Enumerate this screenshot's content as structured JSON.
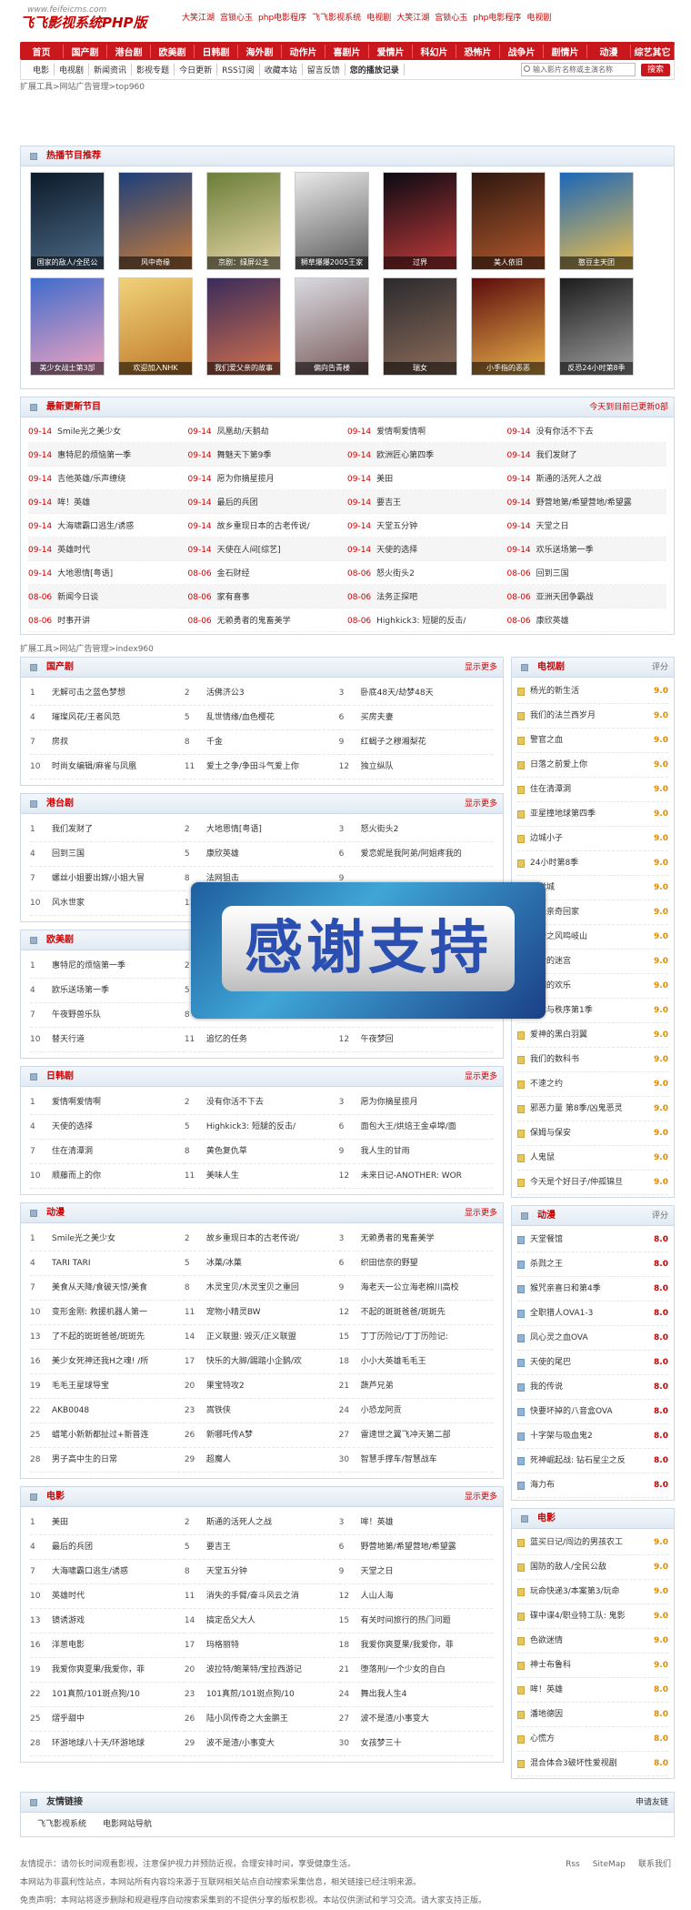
{
  "header": {
    "site_url": "www.feifeicms.com",
    "site_name": "飞飞影视系统PHP版",
    "toplinks": [
      "大笑江湖",
      "宫锁心玉",
      "php电影程序",
      "飞飞影视系统",
      "电视剧",
      "大笑江湖",
      "宫锁心玉",
      "php电影程序",
      "电视剧"
    ]
  },
  "mainnav": [
    "首页",
    "国产剧",
    "港台剧",
    "欧美剧",
    "日韩剧",
    "海外剧",
    "动作片",
    "喜剧片",
    "爱情片",
    "科幻片",
    "恐怖片",
    "战争片",
    "剧情片",
    "动漫",
    "综艺其它"
  ],
  "subnav": [
    "电影",
    "电视剧",
    "新闻资讯",
    "影视专题",
    "今日更新",
    "RSS订阅",
    "收藏本站",
    "留言反馈",
    "您的播放记录"
  ],
  "search": {
    "placeholder": "输入影片名称或主演名称",
    "button": "搜索"
  },
  "crumb1": "扩展工具>网站广告管理>top960",
  "crumb2": "扩展工具>网站广告管理>index960",
  "hot": {
    "title": "热播节目推荐",
    "items": [
      {
        "cap": "国家的敌人/全民公",
        "c1": "#0c1a2a",
        "c2": "#4d6b86"
      },
      {
        "cap": "风中奇缘",
        "c1": "#1d3f7a",
        "c2": "#c87d3c"
      },
      {
        "cap": "京剧：绿屏公主",
        "c1": "#6b7e3a",
        "c2": "#e7d7a6"
      },
      {
        "cap": "狮草爆爆2005王家",
        "c1": "#e9e9e9",
        "c2": "#5a5a5a"
      },
      {
        "cap": "过界",
        "c1": "#0a0a12",
        "c2": "#c23b3b"
      },
      {
        "cap": "美人依旧",
        "c1": "#2e1710",
        "c2": "#b45a2d"
      },
      {
        "cap": "憨豆主天团",
        "c1": "#1b67b8",
        "c2": "#f2c04a"
      },
      {
        "cap": "美少女战士第3部",
        "c1": "#3f6ccc",
        "c2": "#f3a4c0"
      },
      {
        "cap": "欢迎加入NHK",
        "c1": "#f0d27a",
        "c2": "#c07a2a"
      },
      {
        "cap": "我们爱父亲的故事",
        "c1": "#3a2c5c",
        "c2": "#d3704c"
      },
      {
        "cap": "偏向告青楼",
        "c1": "#d9d9e0",
        "c2": "#7a5c5c"
      },
      {
        "cap": "瑞女",
        "c1": "#2b2a2e",
        "c2": "#8d6d5a"
      },
      {
        "cap": "小手指的恶恶",
        "c1": "#5c0c0c",
        "c2": "#e8b04a"
      },
      {
        "cap": "反恐24小时第8季",
        "c1": "#1c1c1c",
        "c2": "#9f9f9f"
      }
    ]
  },
  "updates": {
    "title": "最新更新节目",
    "more": "今天到目前已更新0部",
    "rows": [
      [
        [
          "09-14",
          "Smile光之美少女"
        ],
        [
          "09-14",
          "凤凰劫/天鹅劫"
        ],
        [
          "09-14",
          "爱情啊爱情啊"
        ],
        [
          "09-14",
          "没有你活不下去"
        ]
      ],
      [
        [
          "09-14",
          "惠特尼的烦恼第一季"
        ],
        [
          "09-14",
          "舞魅天下第9季"
        ],
        [
          "09-14",
          "欧洲匠心第四季"
        ],
        [
          "09-14",
          "我们发财了"
        ]
      ],
      [
        [
          "09-14",
          "吉他英雄/乐声缭绕"
        ],
        [
          "09-14",
          "愿为你摘星揽月"
        ],
        [
          "09-14",
          "美田"
        ],
        [
          "09-14",
          "斯通的活死人之战"
        ]
      ],
      [
        [
          "09-14",
          "哞！英雄"
        ],
        [
          "09-14",
          "最后的兵团"
        ],
        [
          "09-14",
          "要吉王"
        ],
        [
          "09-14",
          "野营地第/希望营地/希望露"
        ]
      ],
      [
        [
          "09-14",
          "大海啸霸口逃生/诱惑"
        ],
        [
          "09-14",
          "故乡重现日本的古老传说/"
        ],
        [
          "09-14",
          "天堂五分钟"
        ],
        [
          "09-14",
          "天堂之日"
        ]
      ],
      [
        [
          "09-14",
          "英雄时代"
        ],
        [
          "09-14",
          "天使在人间[综艺]"
        ],
        [
          "09-14",
          "天使的选择"
        ],
        [
          "09-14",
          "欢乐送场第一季"
        ]
      ],
      [
        [
          "09-14",
          "大地恩情[粤语]"
        ],
        [
          "08-06",
          "金石财经"
        ],
        [
          "08-06",
          "怒火街头2"
        ],
        [
          "08-06",
          "回到三国"
        ]
      ],
      [
        [
          "08-06",
          "新闻今日谈"
        ],
        [
          "08-06",
          "家有喜事"
        ],
        [
          "08-06",
          "法务正探吧"
        ],
        [
          "08-06",
          "亚洲天团争霸战"
        ]
      ],
      [
        [
          "08-06",
          "时事开讲"
        ],
        [
          "08-06",
          "无赖勇者的鬼畜美学"
        ],
        [
          "08-06",
          "Highkick3: 短腿的反击/"
        ],
        [
          "08-06",
          "康欣英雄"
        ]
      ]
    ]
  },
  "sections": [
    {
      "title": "国产剧",
      "more": "显示更多",
      "items": [
        "无解可击之蓝色梦想",
        "活佛济公3",
        "卧底48天/劫梦48天",
        "璀璨风花/王者风范",
        "乱世情缘/血色樱花",
        "买房夫妻",
        "房叔",
        "千金",
        "红蝎子之穆湘梨花",
        "时尚女编辑/麻雀与凤凰",
        "爱土之争/争田斗气爱上你",
        "独立纵队"
      ]
    },
    {
      "title": "港台剧",
      "more": "显示更多",
      "items": [
        "我们发财了",
        "大地恩情[粤语]",
        "怒火街头2",
        "回到三国",
        "康欣英雄",
        "爱恋妮是我阿弟/阿姐疼我的",
        "螺丝小姐要出嫁/小姐大冒",
        "法网狙击",
        "",
        "风水世家",
        "",
        ""
      ]
    },
    {
      "title": "欧美剧",
      "more": "显示更多",
      "items": [
        "惠特尼的烦恼第一季",
        "",
        "",
        "欧乐送场第一季",
        "",
        "",
        "午夜野兽乐队",
        "微博有鬼之@直播",
        "仙境大逃课杀案",
        "替天行道",
        "追忆的任务",
        "午夜梦回"
      ]
    },
    {
      "title": "日韩剧",
      "more": "显示更多",
      "items": [
        "爱情啊爱情啊",
        "没有你活不下去",
        "愿为你摘星揽月",
        "天使的选择",
        "Highkick3: 短腿的反击/",
        "面包大王/烘焙王金卓埠/面",
        "住在清潭洞",
        "黄色复仇草",
        "我人生的甘雨",
        "顺藤而上的你",
        "美味人生",
        "未来日记-ANOTHER: WOR"
      ]
    },
    {
      "title": "动漫",
      "more": "显示更多",
      "items": [
        "Smile光之美少女",
        "故乡重现日本的古老传说/",
        "无赖勇者的鬼畜美学",
        "TARI TARI",
        "冰菓/冰菓",
        "织田信奈的野望",
        "美食从天降/食破天惊/美食",
        "木灵宝贝/木灵宝贝之重回",
        "海老天一公立海老棉川高校",
        "变形金刚: 救援机器人第一",
        "宠物小精灵BW",
        "不起的斑斑爸爸/斑斑先",
        "了不起的斑斑爸爸/斑斑先",
        "正义联盟: 毁灭/正义联盟",
        "丁丁历险记/丁丁历险记:",
        "美少女死神还我H之魂! /所",
        "快乐的大脚/踢踏小企鹅/欢",
        "小小大英雄毛毛王",
        "毛毛王星球导宝",
        "果宝特攻2",
        "蔬芦兄弟",
        "AKB0048",
        "嵩铁侠",
        "小恐龙阿贡",
        "蜡笔小新新都扯过+新普连",
        "新哪吒传A梦",
        "雷速世之翼飞冲天第二部",
        "男子高中生的日常",
        "超魔人",
        "智慧手撑车/智慧战车"
      ]
    },
    {
      "title": "电影",
      "more": "显示更多",
      "items": [
        "美田",
        "斯通的活死人之战",
        "哞！英雄",
        "最后的兵团",
        "要吉王",
        "野营地第/希望营地/希望露",
        "大海啸霸口逃生/诱惑",
        "天堂五分钟",
        "天堂之日",
        "英雄时代",
        "消失的手臂/奋斗风云之消",
        "人山人海",
        "镜诱游戏",
        "搞定岳父大人",
        "有关时间旅行的热门问题",
        "洋葱电影",
        "玛格丽特",
        "我爱你爽夏果/我爱你，菲",
        "我爱你爽夏果/我爱你，菲",
        "波拉特/鲍莱特/宝拉西游记",
        "堕落刑/一个少女的自白",
        "101真煎/101斑点狗/10",
        "101真煎/101斑点狗/10",
        "舞出我人生4",
        "熠乎甜中",
        "陆小凤传奇之大金鹏王",
        "波不是渣/小事变大",
        "环游地球八十天/环游地球",
        "波不是渣/小事变大",
        "女孩梦三十"
      ]
    }
  ],
  "right": [
    {
      "title": "电视剧",
      "col": "评分",
      "items": [
        [
          "杨光的新生活",
          "9.0"
        ],
        [
          "我们的法兰西岁月",
          "9.0"
        ],
        [
          "警官之血",
          "9.0"
        ],
        [
          "日落之前爱上你",
          "9.0"
        ],
        [
          "住在清潭洞",
          "9.0"
        ],
        [
          "亚星撞地球第四季",
          "9.0"
        ],
        [
          "边城小子",
          "9.0"
        ],
        [
          "24小时第8季",
          "9.0"
        ],
        [
          "幻觉城",
          "9.0"
        ],
        [
          "快乐亲奇回家",
          "9.0"
        ],
        [
          "特警之风鸣岐山",
          "9.0"
        ],
        [
          "最后的迷宫",
          "9.0"
        ],
        [
          "我们的欢乐",
          "9.0"
        ],
        [
          "法律与秩序第1季",
          "9.0"
        ],
        [
          "爱神的黑白羽翼",
          "9.0"
        ],
        [
          "我们的数科书",
          "9.0"
        ],
        [
          "不速之约",
          "9.0"
        ],
        [
          "邪恶力量 第8季/凶鬼恶灵",
          "9.0"
        ],
        [
          "保姆与保安",
          "9.0"
        ],
        [
          "人鬼鼠",
          "9.0"
        ],
        [
          "今天是个好日子/仲孤锦旦",
          "9.0"
        ]
      ]
    },
    {
      "title": "动漫",
      "col": "评分",
      "items": [
        [
          "天堂餐馆",
          "8.0"
        ],
        [
          "杀戮之王",
          "8.0"
        ],
        [
          "猴咒亲喜日和第4季",
          "8.0"
        ],
        [
          "全职猎人OVA1-3",
          "8.0"
        ],
        [
          "凤心灵之血OVA",
          "8.0"
        ],
        [
          "天使的尾巴",
          "8.0"
        ],
        [
          "我的传说",
          "8.0"
        ],
        [
          "快要坏掉的八音盒OVA",
          "8.0"
        ],
        [
          "十字架与吸血鬼2",
          "8.0"
        ],
        [
          "死神崛起战: 钻石星尘之反",
          "8.0"
        ],
        [
          "海力布",
          "8.0"
        ]
      ]
    },
    {
      "title": "电影",
      "col": "",
      "items": [
        [
          "蓝买日记/闯边的男孩农工",
          "9.0"
        ],
        [
          "国防的敌人/全民公敌",
          "9.0"
        ],
        [
          "玩命快递3/本案第3/玩命",
          "9.0"
        ],
        [
          "碟中谍4/职业特工队: 鬼影",
          "9.0"
        ],
        [
          "色欲迷情",
          "9.0"
        ],
        [
          "神士布鲁科",
          "9.0"
        ],
        [
          "哞！英雄",
          "8.0"
        ],
        [
          "潘地德因",
          "8.0"
        ],
        [
          "心慌方",
          "8.0"
        ],
        [
          "混合体合3破坏性爱视剧",
          "8.0"
        ]
      ]
    }
  ],
  "links": {
    "title": "友情链接",
    "right": "申请友链",
    "items": [
      "飞飞影视系统",
      "电影网站导航"
    ]
  },
  "footer": {
    "line1": "友情提示：请勿长时间观看影视，注意保护视力并预防近视，合理安排时间，享受健康生活。",
    "line2": "本网站为非赢利性站点，本网站所有内容均来源于互联网相关站点自动搜索采集信息，相关链接已经注明来源。",
    "line3": "免责声明：本网站将逐步删除和规避程序自动搜索采集到的不提供分享的版权影视。本站仅供测试和学习交流。请大家支持正版。",
    "right": [
      "Rss",
      "SiteMap",
      "联系我们"
    ]
  },
  "overlay": {
    "text": "感谢支持"
  }
}
